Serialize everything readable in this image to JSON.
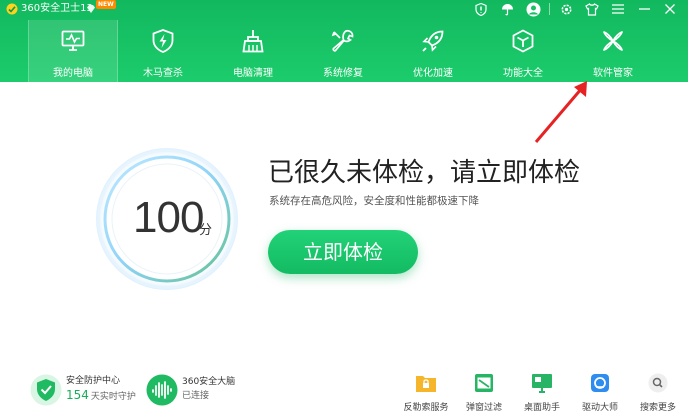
{
  "app": {
    "title": "360安全卫士13",
    "new_badge": "NEW",
    "brand_color": "#19c066"
  },
  "window_controls": [
    {
      "name": "shield-alert-icon"
    },
    {
      "name": "umbrella-icon"
    },
    {
      "name": "user-avatar-icon"
    },
    {
      "name": "settings-gear-icon"
    },
    {
      "name": "skin-shirt-icon"
    },
    {
      "name": "menu-icon"
    },
    {
      "name": "minimize-icon"
    },
    {
      "name": "close-icon"
    }
  ],
  "nav": {
    "items": [
      {
        "label": "我的电脑",
        "icon": "monitor-icon",
        "active": true
      },
      {
        "label": "木马查杀",
        "icon": "shield-bolt-icon",
        "active": false
      },
      {
        "label": "电脑清理",
        "icon": "broom-icon",
        "active": false
      },
      {
        "label": "系统修复",
        "icon": "wrench-icon",
        "active": false
      },
      {
        "label": "优化加速",
        "icon": "rocket-icon",
        "active": false
      },
      {
        "label": "功能大全",
        "icon": "cube-icon",
        "active": false
      },
      {
        "label": "软件管家",
        "icon": "flower-icon",
        "active": false
      }
    ]
  },
  "main": {
    "score": "100",
    "score_unit": "分",
    "headline": "已很久未体检，请立即体检",
    "subline": "系统存在高危风险，安全度和性能都极速下降",
    "scan_button": "立即体检"
  },
  "bottom": {
    "protection": {
      "title": "安全防护中心",
      "days": "154",
      "days_label": "天实时守护"
    },
    "brain": {
      "title": "360安全大脑",
      "status": "已连接"
    },
    "tools": [
      {
        "label": "反勒索服务",
        "icon": "folder-lock-icon"
      },
      {
        "label": "弹窗过滤",
        "icon": "popup-filter-icon"
      },
      {
        "label": "桌面助手",
        "icon": "desktop-helper-icon"
      },
      {
        "label": "驱动大师",
        "icon": "driver-master-icon"
      },
      {
        "label": "搜索更多",
        "icon": "search-icon"
      }
    ]
  }
}
